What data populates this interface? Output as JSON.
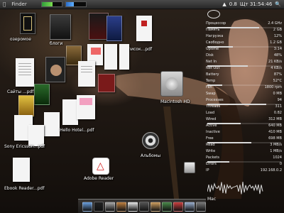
{
  "menubar": {
    "app_title": "Finder",
    "right_items": [
      "▲",
      "0.8",
      "Щт 31:54:46",
      "🔍"
    ],
    "cpu_meter": 0.55,
    "mem_meter": 0.4
  },
  "desktop_items": [
    {
      "label": "озеромое"
    },
    {
      "label": "блоги"
    },
    {
      "label": "Сайты ...pdf"
    },
    {
      "label": "Hello Hotel...pdf"
    },
    {
      "label": "Список...pdf"
    },
    {
      "label": "Sony Ericsson...pdf"
    },
    {
      "label": "Фото"
    },
    {
      "label": "Музыка"
    },
    {
      "label": "Macintosh HD"
    },
    {
      "label": "Adobe Reader"
    },
    {
      "label": "Альбомы"
    },
    {
      "label": "Ebook Reader...pdf"
    },
    {
      "label": "Adobe Reader"
    },
    {
      "label": "Проекты"
    }
  ],
  "system_panel": {
    "rows": [
      [
        "Процессор",
        "2.4 GHz"
      ],
      [
        "Память",
        "2 GB"
      ],
      [
        "Нагрузка",
        "12%"
      ],
      [
        "Свободно",
        "1.2 GB"
      ],
      [
        "Uptime",
        "3:14"
      ],
      [
        "Disk",
        "48%"
      ],
      [
        "Net In",
        "21 KB/s"
      ],
      [
        "Net Out",
        "4 KB/s"
      ],
      [
        "Battery",
        "87%"
      ],
      [
        "Temp",
        "52°C"
      ],
      [
        "Fan",
        "1800 rpm"
      ],
      [
        "Swap",
        "0 MB"
      ],
      [
        "Processes",
        "94"
      ],
      [
        "Threads",
        "311"
      ],
      [
        "Load",
        "0.82"
      ],
      [
        "Wired",
        "312 MB"
      ],
      [
        "Active",
        "640 MB"
      ],
      [
        "Inactive",
        "410 MB"
      ],
      [
        "Free",
        "698 MB"
      ],
      [
        "Read",
        "3 MB/s"
      ],
      [
        "Write",
        "1 MB/s"
      ],
      [
        "Packets",
        "1024"
      ],
      [
        "Errors",
        "0"
      ],
      [
        "IP",
        "192.168.0.2"
      ]
    ],
    "bars": [
      0.7,
      0.35,
      0.55,
      0.2,
      0.8,
      0.45,
      0.6,
      0.3
    ],
    "footer": "Mac"
  },
  "dock": {
    "items": [
      "finder-icon",
      "terminal-icon",
      "tools-icon",
      "stack-icon",
      "mail-icon",
      "media-icon",
      "contacts-icon",
      "photos-icon",
      "user-icon",
      "disk-icon",
      "trash-icon"
    ]
  },
  "colors": {
    "accent": "#d8d8d8",
    "menubar": "#2e2e2e",
    "label_text": "#ffffff"
  }
}
